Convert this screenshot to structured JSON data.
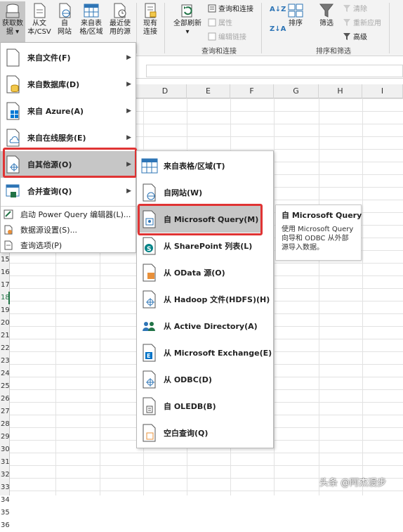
{
  "ribbon": {
    "get_data": "获取数\n据 ▾",
    "from_text_csv": "从文\n本/CSV",
    "from_web": "自\n网站",
    "from_table": "来自表\n格/区域",
    "recent_sources": "最近使\n用的源",
    "existing_conn": "现有\n连接",
    "refresh_all": "全部刷新\n▾",
    "queries_connections": "查询和连接",
    "properties": "属性",
    "edit_links": "编辑链接",
    "group_queries": "查询和连接",
    "sort": "排序",
    "filter": "筛选",
    "clear": "清除",
    "reapply": "重新应用",
    "advanced": "高级",
    "group_sort_filter": "排序和筛选"
  },
  "columns": [
    "D",
    "E",
    "F",
    "G",
    "H",
    "I"
  ],
  "rows": [
    "15",
    "16",
    "17",
    "18",
    "19",
    "20",
    "21",
    "22",
    "23",
    "24",
    "25",
    "26",
    "27",
    "28",
    "29",
    "30",
    "31",
    "32",
    "33",
    "34",
    "35",
    "36"
  ],
  "menu1": {
    "items": [
      {
        "label": "来自文件(F)",
        "icon": "file-icon"
      },
      {
        "label": "来自数据库(D)",
        "icon": "database-icon"
      },
      {
        "label": "来自 Azure(A)",
        "icon": "azure-icon"
      },
      {
        "label": "来自在线服务(E)",
        "icon": "online-services-icon"
      },
      {
        "label": "自其他源(O)",
        "icon": "other-sources-icon"
      },
      {
        "label": "合并查询(Q)",
        "icon": "combine-query-icon"
      }
    ],
    "small": [
      {
        "label": "启动 Power Query 编辑器(L)..."
      },
      {
        "label": "数据源设置(S)..."
      },
      {
        "label": "查询选项(P)"
      }
    ]
  },
  "menu2": {
    "items": [
      {
        "label": "来自表格/区域(T)"
      },
      {
        "label": "自网站(W)"
      },
      {
        "label": "自 Microsoft Query(M)"
      },
      {
        "label": "从 SharePoint 列表(L)"
      },
      {
        "label": "从 OData 源(O)"
      },
      {
        "label": "从 Hadoop 文件(HDFS)(H)"
      },
      {
        "label": "从 Active Directory(A)"
      },
      {
        "label": "从 Microsoft Exchange(E)"
      },
      {
        "label": "从 ODBC(D)"
      },
      {
        "label": "自 OLEDB(B)"
      },
      {
        "label": "空白查询(Q)"
      }
    ]
  },
  "tooltip": {
    "title": "自 Microsoft Query",
    "description": "使用 Microsoft Query 向导和 ODBC 从外部源导入数据。"
  },
  "watermark": "头条 @阿杰漫步",
  "colors": {
    "accent": "#217346",
    "highlight": "#c6c6c6",
    "red": "#e03434"
  }
}
